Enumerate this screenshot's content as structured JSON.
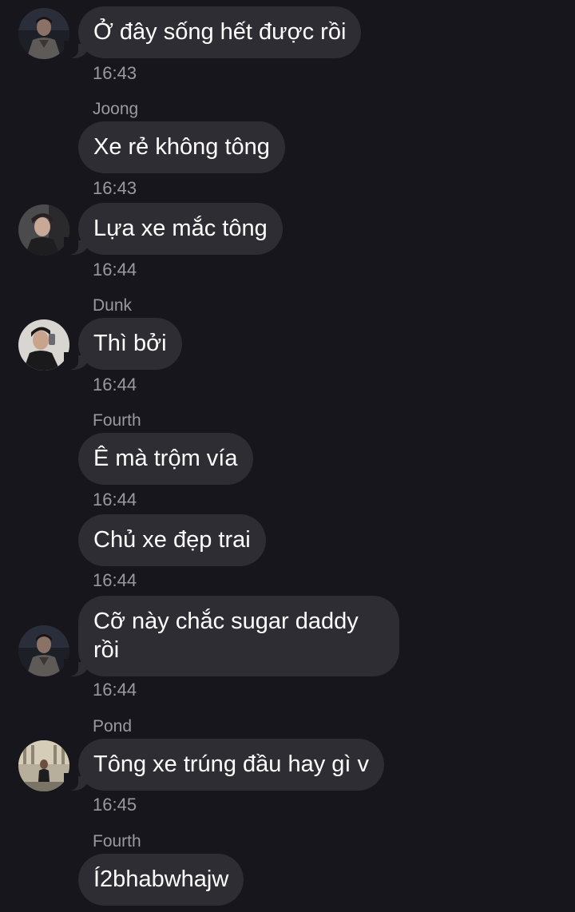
{
  "colors": {
    "background": "#17161c",
    "bubble": "#2e2d33",
    "text": "#ffffff",
    "meta": "#9a99a0"
  },
  "messages": [
    {
      "sender": "",
      "text": "Ở đây sống hết được rồi",
      "time": "16:43",
      "avatar": "avatar-1"
    },
    {
      "sender": "Joong",
      "text": "Xe rẻ không tông",
      "time": "16:43",
      "avatar": ""
    },
    {
      "sender": "",
      "text": "Lựa xe mắc tông",
      "time": "16:44",
      "avatar": "avatar-2"
    },
    {
      "sender": "Dunk",
      "text": "Thì bởi",
      "time": "16:44",
      "avatar": "avatar-3"
    },
    {
      "sender": "Fourth",
      "text": "Ê mà trộm vía",
      "time": "16:44",
      "avatar": ""
    },
    {
      "sender": "",
      "text": "Chủ xe đẹp trai",
      "time": "16:44",
      "avatar": ""
    },
    {
      "sender": "",
      "text": "Cỡ này chắc sugar daddy",
      "text_line2": "rồi",
      "time": "16:44",
      "avatar": "avatar-1"
    },
    {
      "sender": "Pond",
      "text": "Tông xe trúng đầu hay gì v",
      "time": "16:45",
      "avatar": "avatar-4"
    },
    {
      "sender": "Fourth",
      "text": "Í2bhabwhajw",
      "time": "",
      "avatar": ""
    }
  ]
}
